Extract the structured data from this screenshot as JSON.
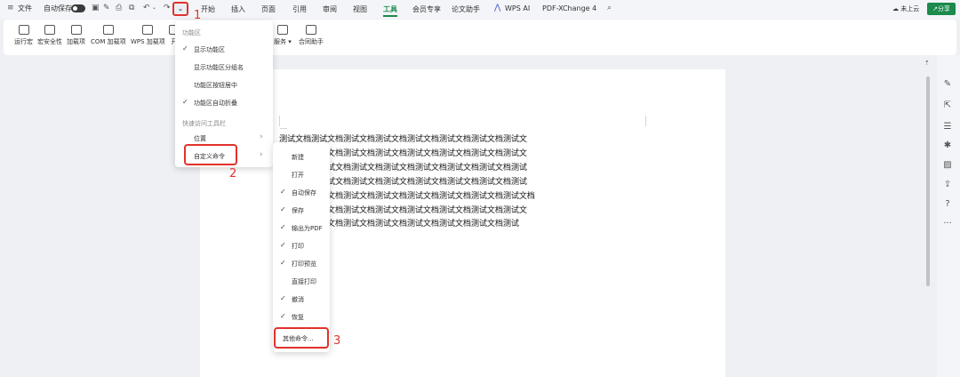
{
  "topbar": {
    "menu_icon": "hamburger-icon",
    "file_label": "文件",
    "autosave_label": "自动保存",
    "tabs": [
      "开始",
      "插入",
      "页面",
      "引用",
      "审阅",
      "视图",
      "工具",
      "会员专享",
      "论文助手",
      "WPS AI",
      "PDF-XChange 4"
    ],
    "active_tab": "工具",
    "cloud_status": "未上云",
    "share_label": "分享"
  },
  "ribbon": {
    "buttons": [
      "运行宏",
      "宏安全性",
      "加载项",
      "COM 加载项",
      "WPS 加载项",
      "开",
      "服务",
      "合同助手"
    ]
  },
  "menu1": {
    "section1_title": "功能区",
    "items": [
      {
        "label": "显示功能区",
        "checked": true
      },
      {
        "label": "显示功能区分组名",
        "checked": false
      },
      {
        "label": "功能区按钮居中",
        "checked": false
      },
      {
        "label": "功能区自动折叠",
        "checked": true
      }
    ],
    "section2_title": "快速访问工具栏",
    "position_label": "位置",
    "customize_label": "自定义命令"
  },
  "menu2": {
    "items": [
      {
        "label": "新建",
        "checked": false
      },
      {
        "label": "打开",
        "checked": false
      },
      {
        "label": "自动保存",
        "checked": true
      },
      {
        "label": "保存",
        "checked": true
      },
      {
        "label": "输出为PDF",
        "checked": true
      },
      {
        "label": "打印",
        "checked": true
      },
      {
        "label": "打印预览",
        "checked": true
      },
      {
        "label": "直接打印",
        "checked": false
      },
      {
        "label": "撤消",
        "checked": true
      },
      {
        "label": "恢复",
        "checked": true
      }
    ],
    "other_label": "其他命令..."
  },
  "annotations": {
    "step1": "1",
    "step2": "2",
    "step3": "3"
  },
  "document": {
    "lines": [
      "测试文档测试文档测试文档测试文档测试文档测试文档测试文档测试文",
      "测试文档测试文档测试文档测试文档测试文档测试文档测试文档测试文",
      "档测试文档测试文档测试文档测试文档测试文档测试文档测试文档测试",
      "档测试文档测试文档测试文档测试文档测试文档测试文档测试文档测试",
      "测试文档测试文档测试文档测试文档测试文档测试文档测试文档测试文档",
      "测试文档测试文档测试文档测试文档测试文档测试文档测试文档测试文",
      "测试文档测试文档测试文档测试文档测试文档测试文档测试文档测试"
    ]
  },
  "colors": {
    "accent": "#1b8a4c",
    "highlight": "#e0322c"
  }
}
